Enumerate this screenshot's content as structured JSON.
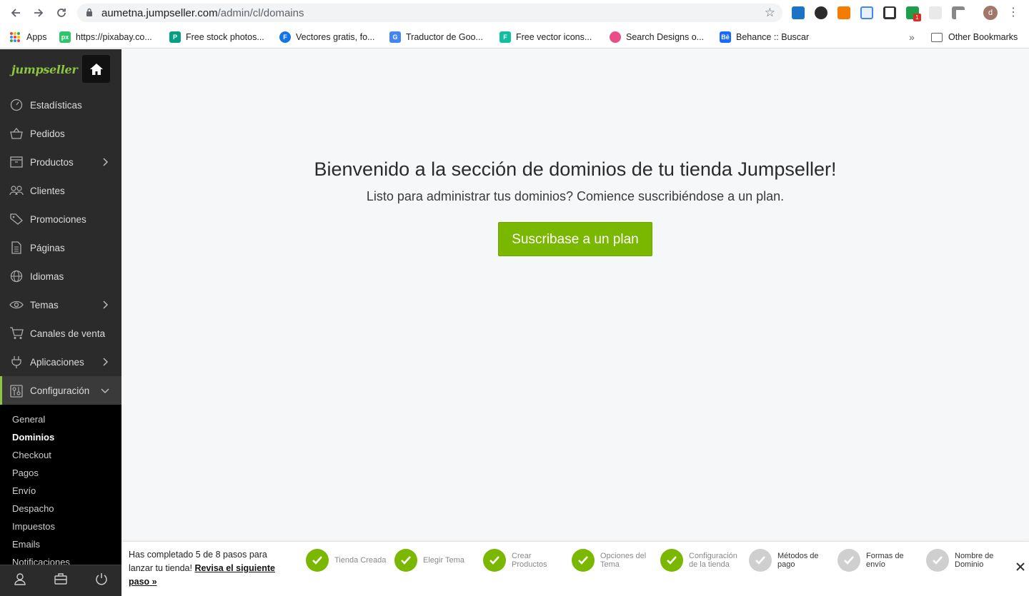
{
  "browser": {
    "url_host": "aumetna.jumpseller.com",
    "url_path": "/admin/cl/domains",
    "avatar_letter": "d",
    "extension_badge": "1"
  },
  "bookmarks": {
    "items": [
      {
        "label": "Apps",
        "icon": "apps-grid-icon"
      },
      {
        "label": "https://pixabay.co...",
        "icon": "pixabay-icon",
        "color": "#2ec66d"
      },
      {
        "label": "Free stock photos...",
        "icon": "pexels-icon",
        "color": "#05a081"
      },
      {
        "label": "Vectores gratis, fo...",
        "icon": "freepik-icon",
        "color": "#1273eb"
      },
      {
        "label": "Traductor de Goo...",
        "icon": "google-translate-icon",
        "color": "#4285f4"
      },
      {
        "label": "Free vector icons...",
        "icon": "flaticon-icon",
        "color": "#0fbfa0"
      },
      {
        "label": "Search Designs o...",
        "icon": "dribbble-icon",
        "color": "#ea4c89"
      },
      {
        "label": "Behance :: Buscar",
        "icon": "behance-icon",
        "color": "#1769ff"
      }
    ],
    "overflow": "»",
    "other": "Other Bookmarks"
  },
  "sidebar": {
    "logo": "jumpseller",
    "items": [
      {
        "label": "Estadísticas",
        "icon": "speedometer-icon",
        "chevron": false
      },
      {
        "label": "Pedidos",
        "icon": "basket-icon",
        "chevron": false
      },
      {
        "label": "Productos",
        "icon": "box-icon",
        "chevron": true
      },
      {
        "label": "Clientes",
        "icon": "users-icon",
        "chevron": false
      },
      {
        "label": "Promociones",
        "icon": "tags-icon",
        "chevron": false
      },
      {
        "label": "Páginas",
        "icon": "document-icon",
        "chevron": false
      },
      {
        "label": "Idiomas",
        "icon": "globe-icon",
        "chevron": false
      },
      {
        "label": "Temas",
        "icon": "eye-icon",
        "chevron": true
      },
      {
        "label": "Canales de venta",
        "icon": "cart-icon",
        "chevron": false
      },
      {
        "label": "Aplicaciones",
        "icon": "plug-icon",
        "chevron": true
      },
      {
        "label": "Configuración",
        "icon": "settings-sliders-icon",
        "chevron": true,
        "active": true
      }
    ],
    "submenu": [
      "General",
      "Dominios",
      "Checkout",
      "Pagos",
      "Envío",
      "Despacho",
      "Impuestos",
      "Emails",
      "Notificaciones"
    ],
    "submenu_selected": "Dominios"
  },
  "main": {
    "headline": "Bienvenido a la sección de dominios de tu tienda Jumpseller!",
    "subline": "Listo para administrar tus dominios? Comience suscribiéndose a un plan.",
    "cta": "Suscribase a un plan",
    "accent_color": "#7ab800"
  },
  "onboarding": {
    "text": "Has completado 5 de 8 pasos para lanzar tu tienda!",
    "link": "Revisa el siguiente paso »",
    "completed": 5,
    "total": 8,
    "steps": [
      {
        "label": "Tienda Creada",
        "done": true
      },
      {
        "label": "Elegir Tema",
        "done": true
      },
      {
        "label": "Crear Productos",
        "done": true
      },
      {
        "label": "Opciones del Tema",
        "done": true
      },
      {
        "label": "Configuración de la tienda",
        "done": true
      },
      {
        "label": "Métodos de pago",
        "done": false
      },
      {
        "label": "Formas de envío",
        "done": false
      },
      {
        "label": "Nombre de Dominio",
        "done": false
      }
    ]
  }
}
